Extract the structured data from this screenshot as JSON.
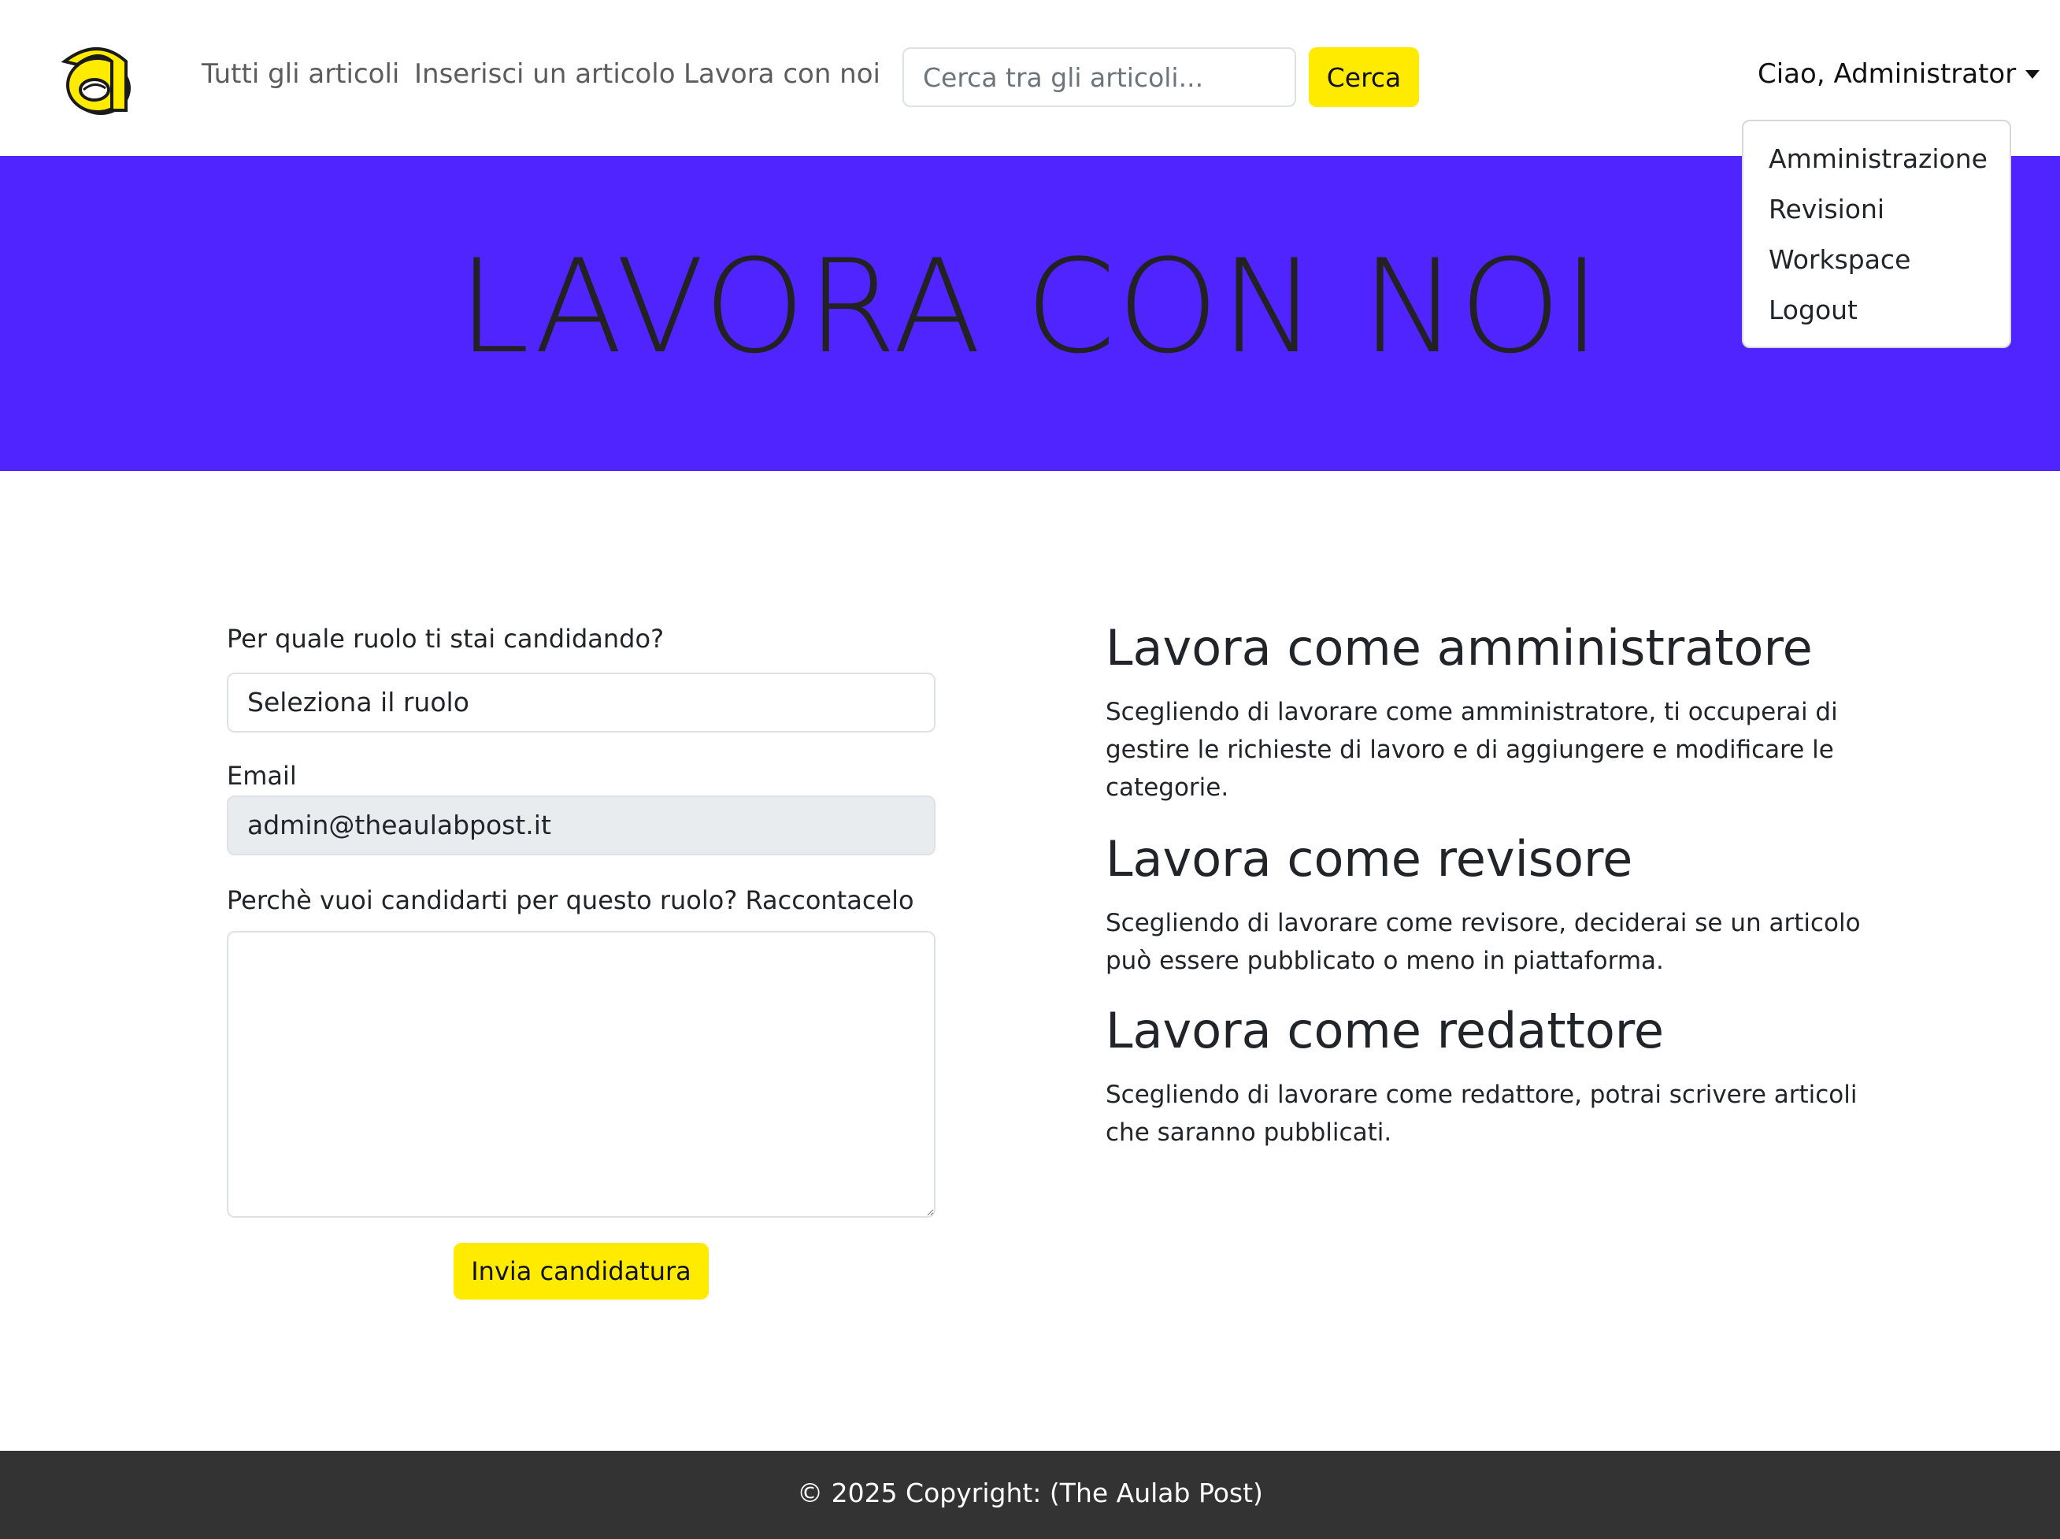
{
  "brand": {
    "logo_letter": "a",
    "logo_color": "#ffeb00"
  },
  "nav": {
    "links": [
      {
        "label": "Tutti gli articoli"
      },
      {
        "label": "Inserisci un articolo"
      },
      {
        "label": "Lavora con noi"
      }
    ],
    "search": {
      "placeholder": "Cerca tra gli articoli...",
      "value": "",
      "button_label": "Cerca"
    },
    "user_label": "Ciao, Administrator",
    "dropdown": {
      "items": [
        {
          "label": "Amministrazione"
        },
        {
          "label": "Revisioni"
        },
        {
          "label": "Workspace"
        },
        {
          "label": "Logout"
        }
      ]
    }
  },
  "hero": {
    "title": "LAVORA CON NOI",
    "background": "#5024fe"
  },
  "form": {
    "role_label": "Per quale ruolo ti stai candidando?",
    "role_selected": "Seleziona il ruolo",
    "email_label": "Email",
    "email_value": "admin@theaulabpost.it",
    "message_label": "Perchè vuoi candidarti per questo ruolo? Raccontacelo",
    "message_value": "",
    "submit_label": "Invia candidatura"
  },
  "roles_info": [
    {
      "title": "Lavora come amministratore",
      "description": "Scegliendo di lavorare come amministratore, ti occuperai di gestire le richieste di lavoro e di aggiungere e modificare le categorie."
    },
    {
      "title": "Lavora come revisore",
      "description": "Scegliendo di lavorare come revisore, deciderai se un articolo può essere pubblicato o meno in piattaforma."
    },
    {
      "title": "Lavora come redattore",
      "description": "Scegliendo di lavorare come redattore, potrai scrivere articoli che saranno pubblicati."
    }
  ],
  "footer": {
    "text": "© 2025 Copyright: (The Aulab Post)"
  },
  "colors": {
    "accent_yellow": "#ffeb00",
    "hero_purple": "#5024fe",
    "footer_bg": "#333333"
  }
}
